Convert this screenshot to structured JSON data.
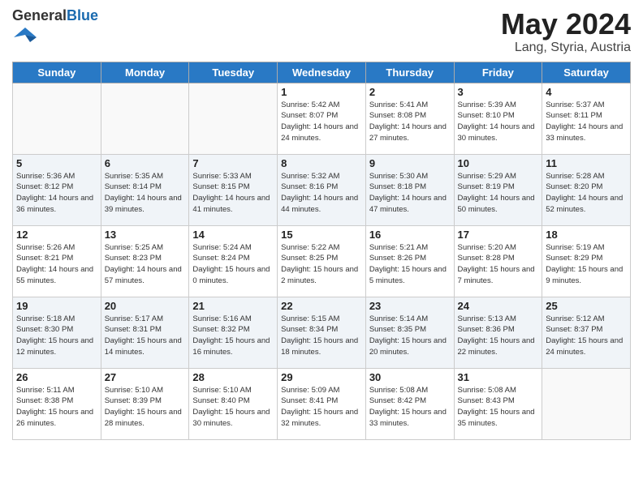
{
  "header": {
    "logo_general": "General",
    "logo_blue": "Blue",
    "month": "May 2024",
    "location": "Lang, Styria, Austria"
  },
  "weekdays": [
    "Sunday",
    "Monday",
    "Tuesday",
    "Wednesday",
    "Thursday",
    "Friday",
    "Saturday"
  ],
  "weeks": [
    [
      {
        "day": "",
        "info": ""
      },
      {
        "day": "",
        "info": ""
      },
      {
        "day": "",
        "info": ""
      },
      {
        "day": "1",
        "info": "Sunrise: 5:42 AM\nSunset: 8:07 PM\nDaylight: 14 hours\nand 24 minutes."
      },
      {
        "day": "2",
        "info": "Sunrise: 5:41 AM\nSunset: 8:08 PM\nDaylight: 14 hours\nand 27 minutes."
      },
      {
        "day": "3",
        "info": "Sunrise: 5:39 AM\nSunset: 8:10 PM\nDaylight: 14 hours\nand 30 minutes."
      },
      {
        "day": "4",
        "info": "Sunrise: 5:37 AM\nSunset: 8:11 PM\nDaylight: 14 hours\nand 33 minutes."
      }
    ],
    [
      {
        "day": "5",
        "info": "Sunrise: 5:36 AM\nSunset: 8:12 PM\nDaylight: 14 hours\nand 36 minutes."
      },
      {
        "day": "6",
        "info": "Sunrise: 5:35 AM\nSunset: 8:14 PM\nDaylight: 14 hours\nand 39 minutes."
      },
      {
        "day": "7",
        "info": "Sunrise: 5:33 AM\nSunset: 8:15 PM\nDaylight: 14 hours\nand 41 minutes."
      },
      {
        "day": "8",
        "info": "Sunrise: 5:32 AM\nSunset: 8:16 PM\nDaylight: 14 hours\nand 44 minutes."
      },
      {
        "day": "9",
        "info": "Sunrise: 5:30 AM\nSunset: 8:18 PM\nDaylight: 14 hours\nand 47 minutes."
      },
      {
        "day": "10",
        "info": "Sunrise: 5:29 AM\nSunset: 8:19 PM\nDaylight: 14 hours\nand 50 minutes."
      },
      {
        "day": "11",
        "info": "Sunrise: 5:28 AM\nSunset: 8:20 PM\nDaylight: 14 hours\nand 52 minutes."
      }
    ],
    [
      {
        "day": "12",
        "info": "Sunrise: 5:26 AM\nSunset: 8:21 PM\nDaylight: 14 hours\nand 55 minutes."
      },
      {
        "day": "13",
        "info": "Sunrise: 5:25 AM\nSunset: 8:23 PM\nDaylight: 14 hours\nand 57 minutes."
      },
      {
        "day": "14",
        "info": "Sunrise: 5:24 AM\nSunset: 8:24 PM\nDaylight: 15 hours\nand 0 minutes."
      },
      {
        "day": "15",
        "info": "Sunrise: 5:22 AM\nSunset: 8:25 PM\nDaylight: 15 hours\nand 2 minutes."
      },
      {
        "day": "16",
        "info": "Sunrise: 5:21 AM\nSunset: 8:26 PM\nDaylight: 15 hours\nand 5 minutes."
      },
      {
        "day": "17",
        "info": "Sunrise: 5:20 AM\nSunset: 8:28 PM\nDaylight: 15 hours\nand 7 minutes."
      },
      {
        "day": "18",
        "info": "Sunrise: 5:19 AM\nSunset: 8:29 PM\nDaylight: 15 hours\nand 9 minutes."
      }
    ],
    [
      {
        "day": "19",
        "info": "Sunrise: 5:18 AM\nSunset: 8:30 PM\nDaylight: 15 hours\nand 12 minutes."
      },
      {
        "day": "20",
        "info": "Sunrise: 5:17 AM\nSunset: 8:31 PM\nDaylight: 15 hours\nand 14 minutes."
      },
      {
        "day": "21",
        "info": "Sunrise: 5:16 AM\nSunset: 8:32 PM\nDaylight: 15 hours\nand 16 minutes."
      },
      {
        "day": "22",
        "info": "Sunrise: 5:15 AM\nSunset: 8:34 PM\nDaylight: 15 hours\nand 18 minutes."
      },
      {
        "day": "23",
        "info": "Sunrise: 5:14 AM\nSunset: 8:35 PM\nDaylight: 15 hours\nand 20 minutes."
      },
      {
        "day": "24",
        "info": "Sunrise: 5:13 AM\nSunset: 8:36 PM\nDaylight: 15 hours\nand 22 minutes."
      },
      {
        "day": "25",
        "info": "Sunrise: 5:12 AM\nSunset: 8:37 PM\nDaylight: 15 hours\nand 24 minutes."
      }
    ],
    [
      {
        "day": "26",
        "info": "Sunrise: 5:11 AM\nSunset: 8:38 PM\nDaylight: 15 hours\nand 26 minutes."
      },
      {
        "day": "27",
        "info": "Sunrise: 5:10 AM\nSunset: 8:39 PM\nDaylight: 15 hours\nand 28 minutes."
      },
      {
        "day": "28",
        "info": "Sunrise: 5:10 AM\nSunset: 8:40 PM\nDaylight: 15 hours\nand 30 minutes."
      },
      {
        "day": "29",
        "info": "Sunrise: 5:09 AM\nSunset: 8:41 PM\nDaylight: 15 hours\nand 32 minutes."
      },
      {
        "day": "30",
        "info": "Sunrise: 5:08 AM\nSunset: 8:42 PM\nDaylight: 15 hours\nand 33 minutes."
      },
      {
        "day": "31",
        "info": "Sunrise: 5:08 AM\nSunset: 8:43 PM\nDaylight: 15 hours\nand 35 minutes."
      },
      {
        "day": "",
        "info": ""
      }
    ]
  ]
}
